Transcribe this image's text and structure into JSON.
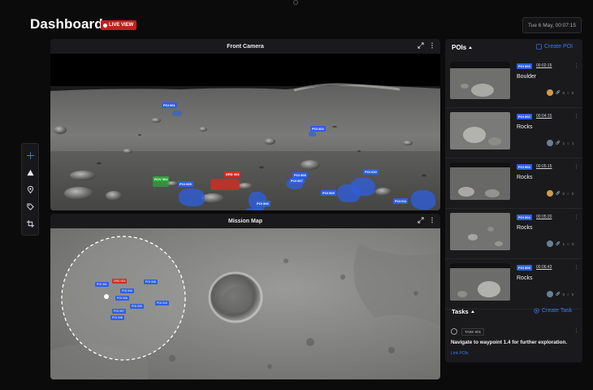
{
  "header": {
    "title": "Dashboard",
    "live_label": "LIVE VIEW",
    "datetime": "Tue 6 May, 00:07:15"
  },
  "toolbar": {
    "tools": [
      "crosshair-icon",
      "triangle-icon",
      "location-pin-icon",
      "tag-icon",
      "crop-icon"
    ]
  },
  "front_camera": {
    "title": "Front Camera",
    "labels": {
      "poi_top": "POI 001",
      "poi_mid": "POI 002",
      "red": "DRD 003",
      "green": "ROV 004",
      "blue_a": "POI 005",
      "blue_b": "POI 006",
      "blue_c": "POI 007",
      "blue_d": "POI 008",
      "blue_e": "POI 009",
      "blue_f": "POI 010",
      "blue_g": "POI 011"
    }
  },
  "mission_map": {
    "title": "Mission Map",
    "labels": {
      "a": "POI 001",
      "b": "DRD 003",
      "c": "POI 004",
      "d": "POI 005",
      "e": "POI 006",
      "f": "POI 007",
      "g": "POI 008",
      "h": "POI 009",
      "i": "POI 010"
    }
  },
  "pois": {
    "title": "POIs",
    "create_label": "Create POI",
    "items": [
      {
        "tag": "POI 003",
        "time": "00:02:15",
        "name": "Boulder",
        "count_a": "0",
        "count_b": "0"
      },
      {
        "tag": "POI 002",
        "time": "00:04:15",
        "name": "Rocks",
        "count_a": "1",
        "count_b": "1"
      },
      {
        "tag": "POI 003",
        "time": "00:05:15",
        "name": "Rocks",
        "count_a": "0",
        "count_b": "0"
      },
      {
        "tag": "POI 004",
        "time": "00:05:20",
        "name": "Rocks",
        "count_a": "1",
        "count_b": "3"
      },
      {
        "tag": "POI 005",
        "time": "00:06:43",
        "name": "Rocks",
        "count_a": "0",
        "count_b": "0"
      }
    ]
  },
  "tasks": {
    "title": "Tasks",
    "create_label": "Create Task",
    "item": {
      "tag": "TASK 001",
      "description": "Navigate to waypoint 1.4 for further exploration.",
      "link": "Link POIs"
    }
  },
  "colors": {
    "accent": "#3a78f2",
    "live": "#c0201e",
    "poi_tag": "#2d5fe0",
    "panel": "#1a1a1c"
  }
}
